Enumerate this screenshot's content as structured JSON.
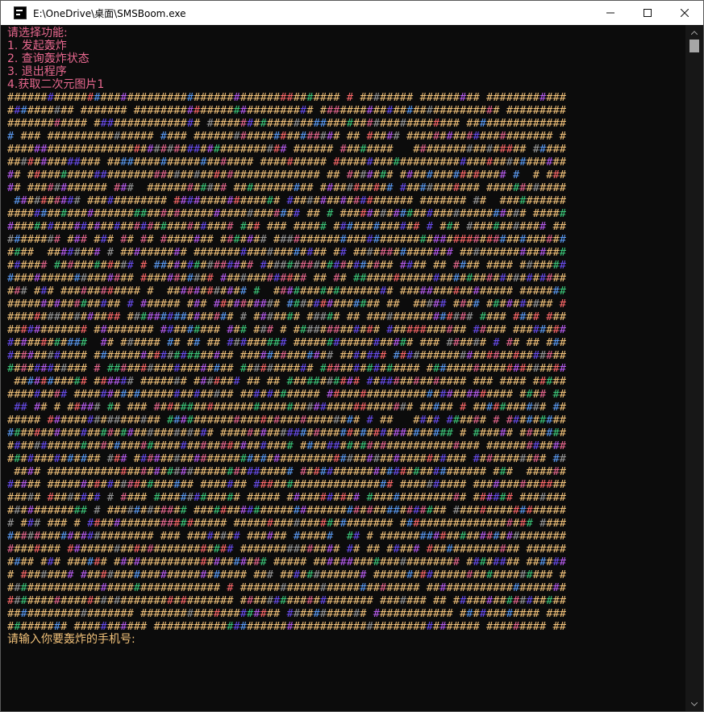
{
  "window": {
    "title": "E:\\OneDrive\\桌面\\SMSBoom.exe"
  },
  "console": {
    "menu": [
      "请选择功能:",
      "1. 发起轰炸",
      "2. 查询轰炸状态",
      "3. 退出程序",
      "4.获取二次元图片1"
    ],
    "art_char": "#",
    "art_rows": 42,
    "art_cols": 84,
    "prompt": "请输入你要轰炸的手机号:"
  },
  "colors": {
    "background": "#0c0c0c",
    "menu_text": "#e8688f",
    "prompt_text": "#f2c27a",
    "art_base": "#f2c27a",
    "art_palette": [
      "#f2c27a",
      "#e8688f",
      "#5c9cf5",
      "#3cc87a",
      "#b85cf0",
      "#ff6a6a",
      "#9a9a9a",
      "#6a4df0"
    ]
  }
}
